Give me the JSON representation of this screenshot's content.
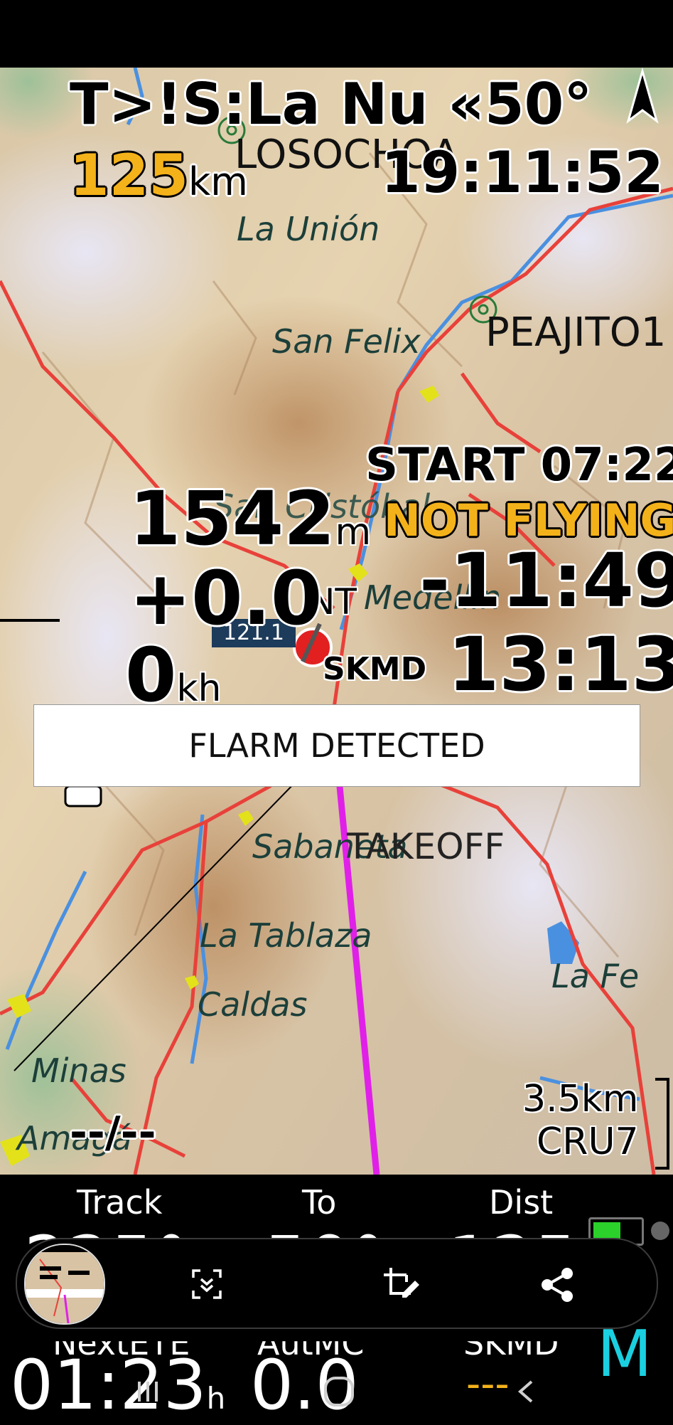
{
  "header": {
    "task_line": "T>!S:La Nu «50°",
    "distance_value": "125",
    "distance_unit": "km",
    "clock": "19:11:52"
  },
  "map": {
    "waypoints": [
      "LOSOCHOA",
      "PEAJITO1",
      "SKMD",
      "TAKEOFF"
    ],
    "places": [
      "La Unión",
      "San Felix",
      "San Cristóbal",
      "Medellín",
      "Sabaneta",
      "La Tablaza",
      "Caldas",
      "La Fe",
      "Minas",
      "Amagá"
    ],
    "frequency_label": "121.1",
    "nt_label": "NT",
    "scale_distance": "3.5km",
    "scale_waypoint": "CRU7",
    "wind_readout": "--/--"
  },
  "overlay": {
    "start_time": "START 07:22",
    "flight_status": "NOT FLYING",
    "altitude_value": "1542",
    "altitude_unit": "m",
    "vario_value": "+0.0",
    "speed_value": "0",
    "speed_unit": "kh",
    "countdown": "-11:49",
    "time_remaining": "13:13"
  },
  "toast": {
    "message": "FLARM DETECTED"
  },
  "infobar": {
    "labels": [
      "Track",
      "To",
      "Dist",
      "NextETE",
      "AutMC",
      "SKMD"
    ],
    "partial_values": [
      "225°",
      "50°",
      "125"
    ],
    "next_ete_value": "01:23",
    "next_ete_unit": "h",
    "autmc_value": "0.0",
    "skmd_value": "---",
    "mode_letter": "M"
  },
  "share_bar": {
    "thumbnail_label": "screenshot-thumbnail",
    "actions": [
      "expand-capture",
      "edit-crop",
      "share"
    ]
  },
  "nav": [
    "recent-apps",
    "home",
    "back"
  ],
  "colors": {
    "accent_yellow": "#f4b21a",
    "track_magenta": "#e020e8",
    "road_red": "#e8413a",
    "river_blue": "#4a90e0",
    "mode_cyan": "#1ad0e0"
  }
}
